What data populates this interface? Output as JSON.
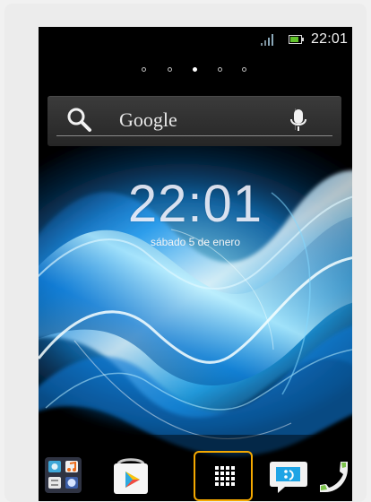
{
  "status_bar": {
    "time": "22:01",
    "icons": [
      "signal-icon",
      "battery-icon"
    ],
    "colors": {
      "signal": "#8aa7b8",
      "battery": "#61c32b"
    }
  },
  "home_pages": {
    "count": 5,
    "active_index": 2
  },
  "search_widget": {
    "label": "Google",
    "icons": [
      "search-icon",
      "mic-icon"
    ]
  },
  "clock_widget": {
    "time": "22:01",
    "date": "sábado 5 de enero"
  },
  "dock": {
    "items": [
      {
        "name": "media-folder",
        "icon": "folder-icon"
      },
      {
        "name": "play-store",
        "icon": "shopping-bag-icon"
      },
      {
        "name": "app-drawer",
        "icon": "apps-grid-icon",
        "highlight_color": "#f4a800"
      },
      {
        "name": "messaging",
        "icon": "messaging-icon"
      },
      {
        "name": "phone",
        "icon": "phone-icon"
      }
    ]
  },
  "colors": {
    "wallpaper_bg": "#000000",
    "wallpaper_accent": "#39b9ff",
    "highlight": "#f4a800"
  }
}
